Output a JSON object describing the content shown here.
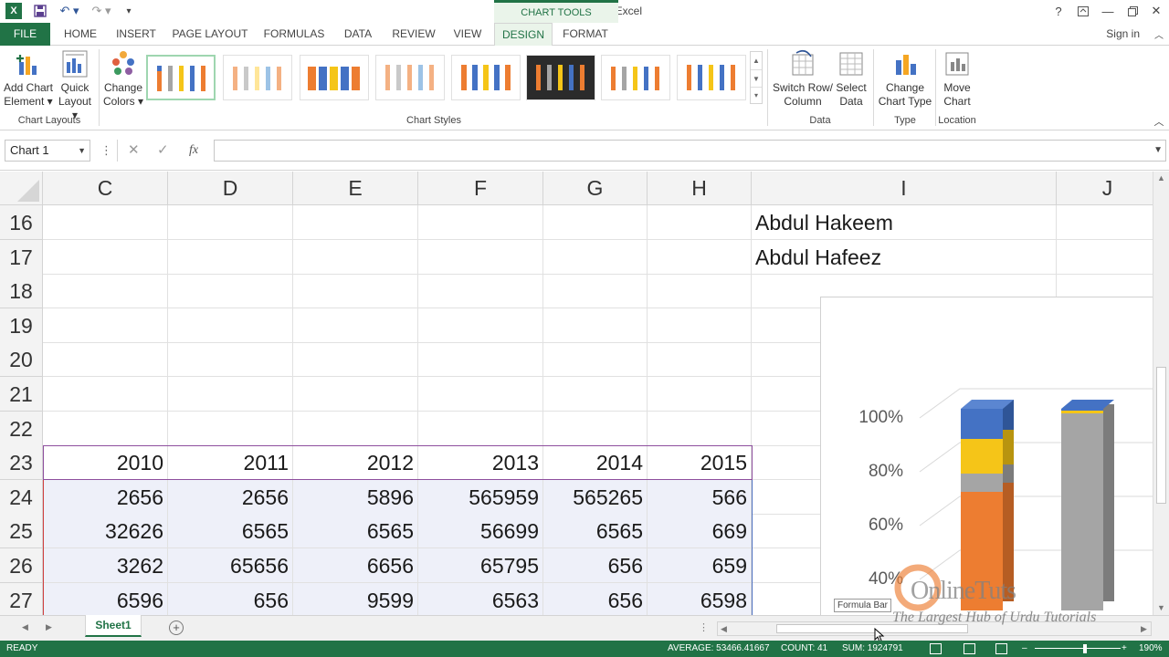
{
  "window": {
    "title": "Book4 - Microsoft Excel",
    "context_tab": "CHART TOOLS",
    "help": "?",
    "sign_in": "Sign in"
  },
  "quick_access": [
    "save-icon",
    "undo-icon",
    "redo-icon",
    "customize-icon"
  ],
  "ribbon_tabs": [
    "FILE",
    "HOME",
    "INSERT",
    "PAGE LAYOUT",
    "FORMULAS",
    "DATA",
    "REVIEW",
    "VIEW",
    "DESIGN",
    "FORMAT"
  ],
  "active_tab": "DESIGN",
  "ribbon": {
    "add_chart_element": "Add Chart Element",
    "add_chart_element_l1": "Add Chart",
    "add_chart_element_l2": "Element ▾",
    "quick_layout_l1": "Quick",
    "quick_layout_l2": "Layout ▾",
    "change_colors_l1": "Change",
    "change_colors_l2": "Colors ▾",
    "group_chart_layouts": "Chart Layouts",
    "group_chart_styles": "Chart Styles",
    "switch_row_col_l1": "Switch Row/",
    "switch_row_col_l2": "Column",
    "select_data_l1": "Select",
    "select_data_l2": "Data",
    "group_data": "Data",
    "change_chart_type_l1": "Change",
    "change_chart_type_l2": "Chart Type",
    "group_type": "Type",
    "move_chart_l1": "Move",
    "move_chart_l2": "Chart",
    "group_location": "Location"
  },
  "formula_bar": {
    "name_box": "Chart 1",
    "fx": "fx",
    "formula": ""
  },
  "columns": [
    "C",
    "D",
    "E",
    "F",
    "G",
    "H",
    "I",
    "J"
  ],
  "rows": [
    {
      "num": "16",
      "cells": [
        "",
        "",
        "",
        "",
        "",
        "",
        "Abdul Hakeem",
        ""
      ]
    },
    {
      "num": "17",
      "cells": [
        "",
        "",
        "",
        "",
        "",
        "",
        "Abdul Hafeez",
        ""
      ]
    },
    {
      "num": "18",
      "cells": [
        "",
        "",
        "",
        "",
        "",
        "",
        "",
        ""
      ]
    },
    {
      "num": "19",
      "cells": [
        "",
        "",
        "",
        "",
        "",
        "",
        "",
        ""
      ]
    },
    {
      "num": "20",
      "cells": [
        "",
        "",
        "",
        "",
        "",
        "",
        "",
        ""
      ]
    },
    {
      "num": "21",
      "cells": [
        "",
        "",
        "",
        "",
        "",
        "",
        "",
        ""
      ]
    },
    {
      "num": "22",
      "cells": [
        "",
        "",
        "",
        "",
        "",
        "",
        "",
        ""
      ]
    },
    {
      "num": "23",
      "cells": [
        "2010",
        "2011",
        "2012",
        "2013",
        "2014",
        "2015",
        "",
        ""
      ]
    },
    {
      "num": "24",
      "cells": [
        "2656",
        "2656",
        "5896",
        "565959",
        "565265",
        "566",
        "",
        ""
      ]
    },
    {
      "num": "25",
      "cells": [
        "32626",
        "6565",
        "6565",
        "56699",
        "6565",
        "669",
        "",
        ""
      ]
    },
    {
      "num": "26",
      "cells": [
        "3262",
        "65656",
        "6656",
        "65795",
        "656",
        "659",
        "",
        ""
      ]
    },
    {
      "num": "27",
      "cells": [
        "6596",
        "656",
        "9599",
        "6563",
        "656",
        "6598",
        "",
        ""
      ]
    }
  ],
  "chart": {
    "y_axis_labels": [
      "100%",
      "80%",
      "60%",
      "40%"
    ],
    "colors": {
      "blue": "#4472c4",
      "yellow": "#f5c518",
      "gray": "#a5a5a5",
      "orange": "#ed7d31"
    }
  },
  "tooltip": "Formula Bar",
  "sheet_tab": "Sheet1",
  "watermark": {
    "brand": "OnlineTuts",
    "tagline": "The Largest Hub of Urdu Tutorials"
  },
  "status": {
    "ready": "READY",
    "average": "AVERAGE: 53466.41667",
    "count": "COUNT: 41",
    "sum": "SUM: 1924791",
    "zoom": "190%"
  }
}
